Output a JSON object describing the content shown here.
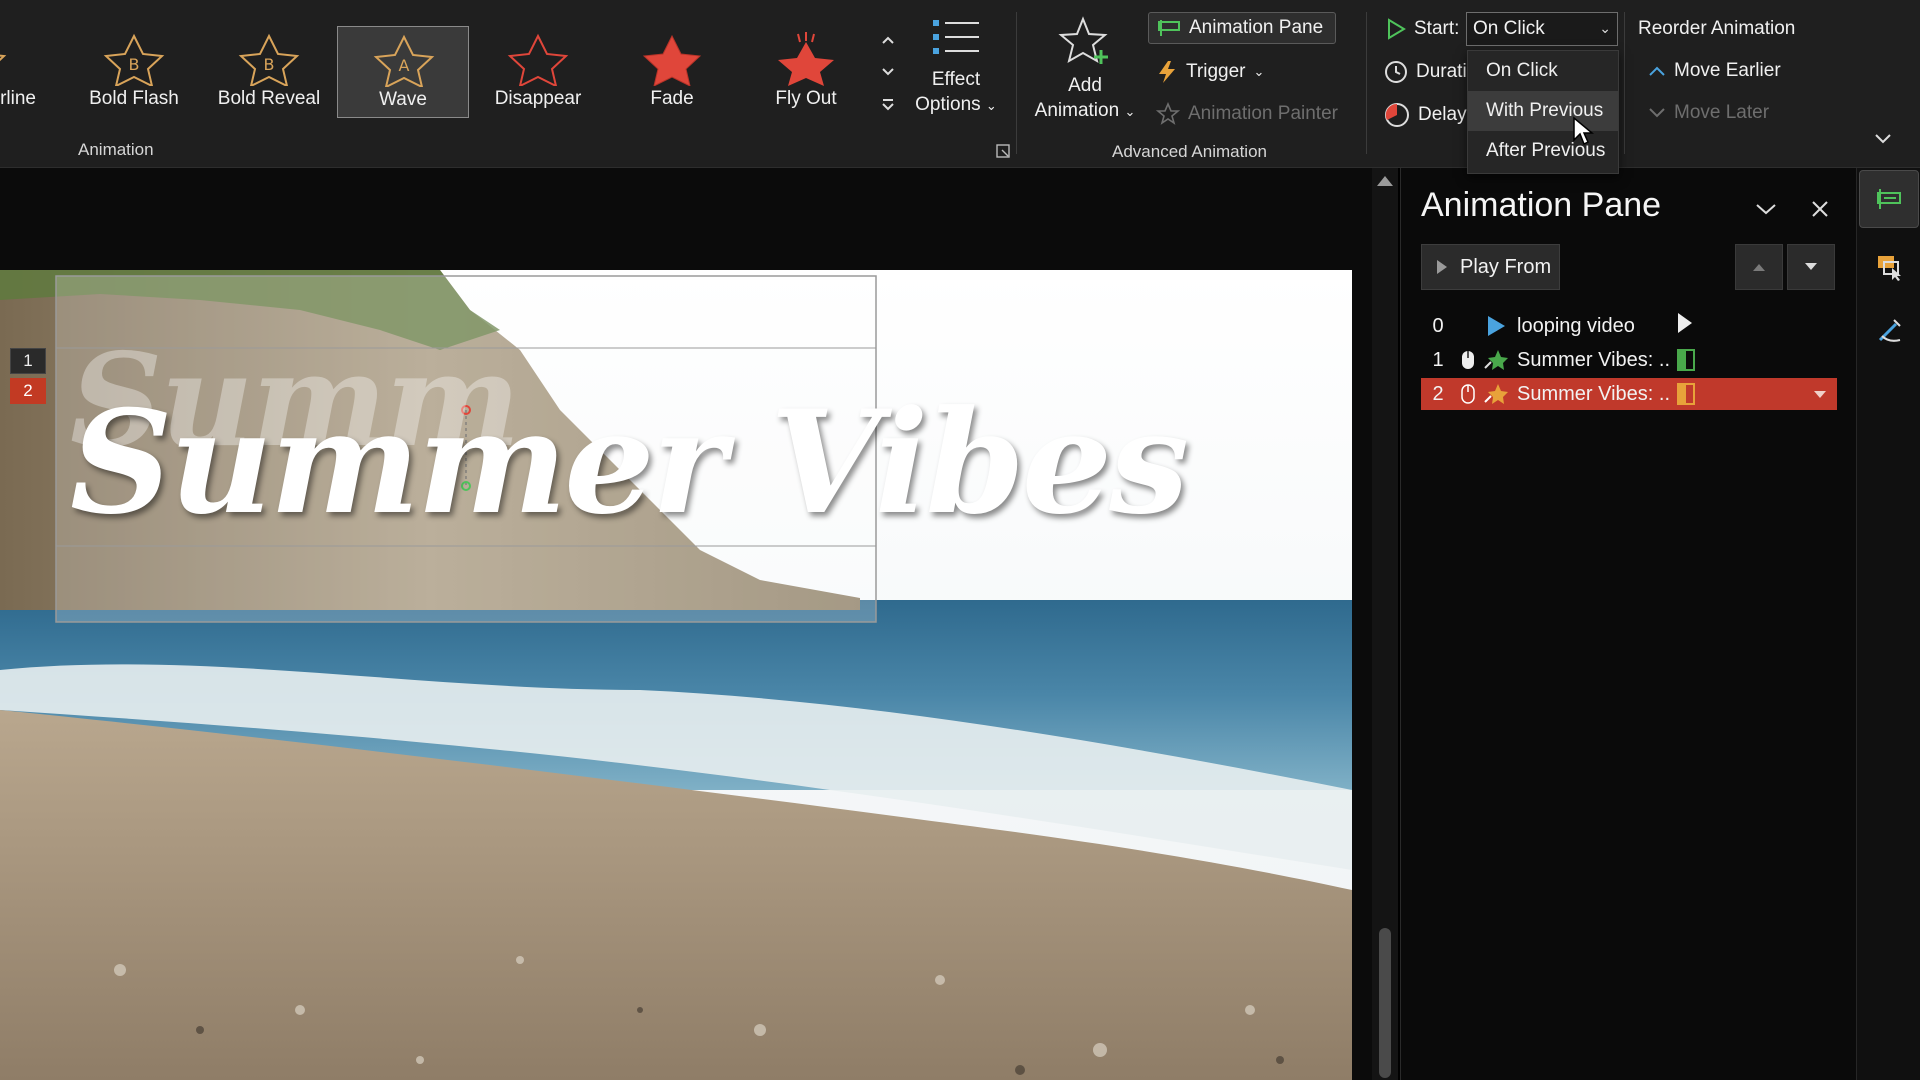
{
  "ribbon": {
    "gallery": [
      {
        "label": "erline",
        "icon": "outline-star-icon",
        "color": "#d9a45a"
      },
      {
        "label": "Bold Flash",
        "icon": "bold-flash-star-icon",
        "color": "#d9a45a"
      },
      {
        "label": "Bold Reveal",
        "icon": "bold-reveal-star-icon",
        "color": "#d9a45a"
      },
      {
        "label": "Wave",
        "icon": "wave-star-icon",
        "color": "#d9a45a"
      },
      {
        "label": "Disappear",
        "icon": "disappear-star-icon",
        "color": "#e0463a"
      },
      {
        "label": "Fade",
        "icon": "fade-star-icon",
        "color": "#e0463a"
      },
      {
        "label": "Fly Out",
        "icon": "fly-out-star-icon",
        "color": "#e0463a"
      }
    ],
    "selected_effect": "Wave",
    "animation_group_label": "Animation",
    "effect_options": {
      "line1": "Effect",
      "line2": "Options"
    },
    "add_animation": {
      "line1": "Add",
      "line2": "Animation"
    },
    "animation_pane_label": "Animation Pane",
    "trigger_label": "Trigger",
    "animation_painter_label": "Animation Painter",
    "advanced_group_label": "Advanced Animation",
    "start_label": "Start:",
    "start_value": "On Click",
    "duration_label": "Durati",
    "delay_label": "Delay:",
    "reorder_label": "Reorder Animation",
    "move_earlier_label": "Move Earlier",
    "move_later_label": "Move Later",
    "start_options": [
      "On Click",
      "With Previous",
      "After Previous"
    ],
    "hovered_option": "With Previous"
  },
  "slide": {
    "title_text": "Summer Vibes",
    "ghost_text": "Summ",
    "animation_tags": [
      "1",
      "2"
    ]
  },
  "animation_pane": {
    "title": "Animation Pane",
    "play_from_label": "Play From",
    "items": [
      {
        "index": "0",
        "name": "looping video",
        "type": "media",
        "selected": false
      },
      {
        "index": "1",
        "name": "Summer Vibes: ...",
        "type": "on-click",
        "bar_color": "#49a84b",
        "selected": false
      },
      {
        "index": "2",
        "name": "Summer Vibes: ...",
        "type": "on-click",
        "bar_color": "#e8a23a",
        "selected": true
      }
    ],
    "selected_color": "#c0392b"
  },
  "colors": {
    "ribbon_bg": "#1f1f1f",
    "accent_red": "#c0392b",
    "text": "#f2f2f2"
  }
}
